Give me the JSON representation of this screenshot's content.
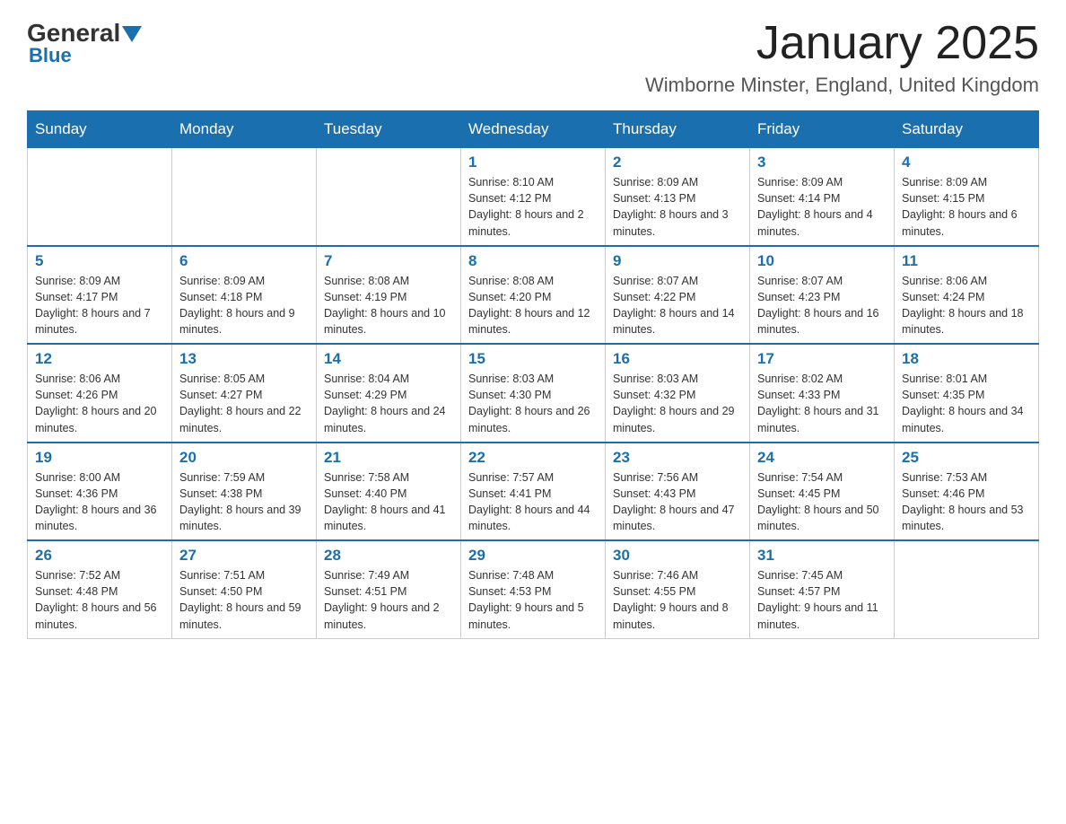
{
  "logo": {
    "general": "General",
    "blue": "Blue",
    "sub": "Blue"
  },
  "title": "January 2025",
  "subtitle": "Wimborne Minster, England, United Kingdom",
  "days_of_week": [
    "Sunday",
    "Monday",
    "Tuesday",
    "Wednesday",
    "Thursday",
    "Friday",
    "Saturday"
  ],
  "weeks": [
    [
      {
        "day": "",
        "info": ""
      },
      {
        "day": "",
        "info": ""
      },
      {
        "day": "",
        "info": ""
      },
      {
        "day": "1",
        "info": "Sunrise: 8:10 AM\nSunset: 4:12 PM\nDaylight: 8 hours and 2 minutes."
      },
      {
        "day": "2",
        "info": "Sunrise: 8:09 AM\nSunset: 4:13 PM\nDaylight: 8 hours and 3 minutes."
      },
      {
        "day": "3",
        "info": "Sunrise: 8:09 AM\nSunset: 4:14 PM\nDaylight: 8 hours and 4 minutes."
      },
      {
        "day": "4",
        "info": "Sunrise: 8:09 AM\nSunset: 4:15 PM\nDaylight: 8 hours and 6 minutes."
      }
    ],
    [
      {
        "day": "5",
        "info": "Sunrise: 8:09 AM\nSunset: 4:17 PM\nDaylight: 8 hours and 7 minutes."
      },
      {
        "day": "6",
        "info": "Sunrise: 8:09 AM\nSunset: 4:18 PM\nDaylight: 8 hours and 9 minutes."
      },
      {
        "day": "7",
        "info": "Sunrise: 8:08 AM\nSunset: 4:19 PM\nDaylight: 8 hours and 10 minutes."
      },
      {
        "day": "8",
        "info": "Sunrise: 8:08 AM\nSunset: 4:20 PM\nDaylight: 8 hours and 12 minutes."
      },
      {
        "day": "9",
        "info": "Sunrise: 8:07 AM\nSunset: 4:22 PM\nDaylight: 8 hours and 14 minutes."
      },
      {
        "day": "10",
        "info": "Sunrise: 8:07 AM\nSunset: 4:23 PM\nDaylight: 8 hours and 16 minutes."
      },
      {
        "day": "11",
        "info": "Sunrise: 8:06 AM\nSunset: 4:24 PM\nDaylight: 8 hours and 18 minutes."
      }
    ],
    [
      {
        "day": "12",
        "info": "Sunrise: 8:06 AM\nSunset: 4:26 PM\nDaylight: 8 hours and 20 minutes."
      },
      {
        "day": "13",
        "info": "Sunrise: 8:05 AM\nSunset: 4:27 PM\nDaylight: 8 hours and 22 minutes."
      },
      {
        "day": "14",
        "info": "Sunrise: 8:04 AM\nSunset: 4:29 PM\nDaylight: 8 hours and 24 minutes."
      },
      {
        "day": "15",
        "info": "Sunrise: 8:03 AM\nSunset: 4:30 PM\nDaylight: 8 hours and 26 minutes."
      },
      {
        "day": "16",
        "info": "Sunrise: 8:03 AM\nSunset: 4:32 PM\nDaylight: 8 hours and 29 minutes."
      },
      {
        "day": "17",
        "info": "Sunrise: 8:02 AM\nSunset: 4:33 PM\nDaylight: 8 hours and 31 minutes."
      },
      {
        "day": "18",
        "info": "Sunrise: 8:01 AM\nSunset: 4:35 PM\nDaylight: 8 hours and 34 minutes."
      }
    ],
    [
      {
        "day": "19",
        "info": "Sunrise: 8:00 AM\nSunset: 4:36 PM\nDaylight: 8 hours and 36 minutes."
      },
      {
        "day": "20",
        "info": "Sunrise: 7:59 AM\nSunset: 4:38 PM\nDaylight: 8 hours and 39 minutes."
      },
      {
        "day": "21",
        "info": "Sunrise: 7:58 AM\nSunset: 4:40 PM\nDaylight: 8 hours and 41 minutes."
      },
      {
        "day": "22",
        "info": "Sunrise: 7:57 AM\nSunset: 4:41 PM\nDaylight: 8 hours and 44 minutes."
      },
      {
        "day": "23",
        "info": "Sunrise: 7:56 AM\nSunset: 4:43 PM\nDaylight: 8 hours and 47 minutes."
      },
      {
        "day": "24",
        "info": "Sunrise: 7:54 AM\nSunset: 4:45 PM\nDaylight: 8 hours and 50 minutes."
      },
      {
        "day": "25",
        "info": "Sunrise: 7:53 AM\nSunset: 4:46 PM\nDaylight: 8 hours and 53 minutes."
      }
    ],
    [
      {
        "day": "26",
        "info": "Sunrise: 7:52 AM\nSunset: 4:48 PM\nDaylight: 8 hours and 56 minutes."
      },
      {
        "day": "27",
        "info": "Sunrise: 7:51 AM\nSunset: 4:50 PM\nDaylight: 8 hours and 59 minutes."
      },
      {
        "day": "28",
        "info": "Sunrise: 7:49 AM\nSunset: 4:51 PM\nDaylight: 9 hours and 2 minutes."
      },
      {
        "day": "29",
        "info": "Sunrise: 7:48 AM\nSunset: 4:53 PM\nDaylight: 9 hours and 5 minutes."
      },
      {
        "day": "30",
        "info": "Sunrise: 7:46 AM\nSunset: 4:55 PM\nDaylight: 9 hours and 8 minutes."
      },
      {
        "day": "31",
        "info": "Sunrise: 7:45 AM\nSunset: 4:57 PM\nDaylight: 9 hours and 11 minutes."
      },
      {
        "day": "",
        "info": ""
      }
    ]
  ]
}
